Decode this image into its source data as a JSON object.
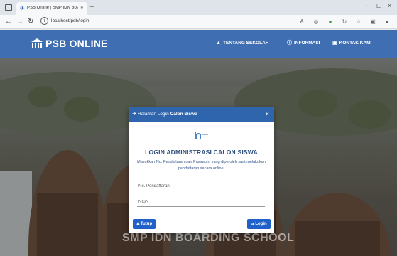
{
  "browser": {
    "tab_title": "PSB Online | SMP IDN Boarding",
    "tab_close": "×",
    "new_tab": "+",
    "url": "localhost/psb/login",
    "window_minimize": "–",
    "window_maximize": "☐",
    "window_close": "×",
    "back_icon": "arrow-left-icon",
    "forward_icon": "arrow-right-icon",
    "reload_icon": "reload-icon"
  },
  "navbar": {
    "brand": "PSB ONLINE",
    "menu": [
      {
        "label": "TENTANG SEKOLAH",
        "icon": "school-icon"
      },
      {
        "label": "INFORMASI",
        "icon": "info-icon"
      },
      {
        "label": "KONTAK KAMI",
        "icon": "contact-icon"
      }
    ]
  },
  "hero": {
    "caption": "SMP IDN BOARDING SCHOOL"
  },
  "modal": {
    "header_prefix": "Halaman Login ",
    "header_bold": "Calon Siswa",
    "close": "×",
    "heading": "LOGIN ADMINISTRASI CALON SISWA",
    "description": "Masukkan No. Pendaftaran dan Password yang diperoleh saat melakukan pendaftaran secara online.",
    "fields": {
      "registration_placeholder": "No. Pendaftaran",
      "nisn_placeholder": "NISN"
    },
    "buttons": {
      "close_label": "Tutup",
      "login_label": "Login"
    }
  },
  "colors": {
    "navbar": "#3f6fb2",
    "modal_header": "#2f65ad",
    "button": "#1f61c9",
    "heading": "#2f4f7f"
  }
}
